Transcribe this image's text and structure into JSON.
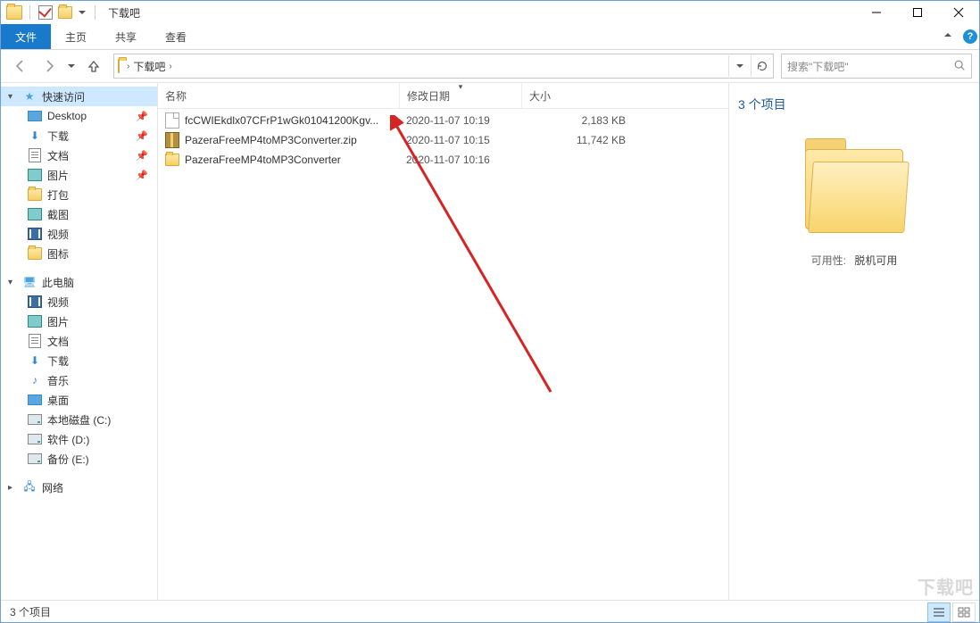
{
  "titlebar": {
    "title": "下载吧"
  },
  "ribbon": {
    "file": "文件",
    "home": "主页",
    "share": "共享",
    "view": "查看"
  },
  "address": {
    "crumb": "下载吧"
  },
  "search": {
    "placeholder": "搜索\"下载吧\""
  },
  "nav": {
    "quick_access": "快速访问",
    "desktop": "Desktop",
    "downloads": "下载",
    "documents": "文档",
    "pictures": "图片",
    "dabao": "打包",
    "jietu": "截图",
    "shipin": "视频",
    "tubiao": "图标",
    "this_pc": "此电脑",
    "pc_videos": "视频",
    "pc_pictures": "图片",
    "pc_documents": "文档",
    "pc_downloads": "下载",
    "pc_music": "音乐",
    "pc_desktop": "桌面",
    "drive_c": "本地磁盘 (C:)",
    "drive_d": "软件 (D:)",
    "drive_e": "备份 (E:)",
    "network": "网络"
  },
  "columns": {
    "name": "名称",
    "date": "修改日期",
    "size": "大小"
  },
  "files": [
    {
      "icon": "file",
      "name": "fcCWIEkdlx07CFrP1wGk01041200Kgv...",
      "date": "2020-11-07 10:19",
      "size": "2,183 KB"
    },
    {
      "icon": "zip",
      "name": "PazeraFreeMP4toMP3Converter.zip",
      "date": "2020-11-07 10:15",
      "size": "11,742 KB"
    },
    {
      "icon": "folder",
      "name": "PazeraFreeMP4toMP3Converter",
      "date": "2020-11-07 10:16",
      "size": ""
    }
  ],
  "preview": {
    "heading": "3 个项目",
    "availability_label": "可用性:",
    "availability_value": "脱机可用"
  },
  "status": {
    "text": "3 个项目"
  },
  "watermark": "下载吧"
}
